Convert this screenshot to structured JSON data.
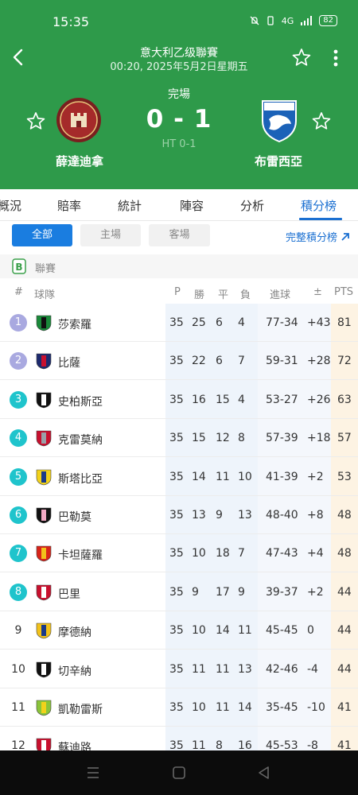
{
  "status_bar": {
    "time": "15:35",
    "net": "4G",
    "battery": "82"
  },
  "match": {
    "league": "意大利乙级聯賽",
    "datetime": "00:20, 2025年5月2日星期五",
    "status": "完場",
    "score": "0 - 1",
    "halftime": "HT 0-1",
    "home": {
      "name": "薛達迪拿"
    },
    "away": {
      "name": "布雷西亞"
    }
  },
  "tabs": [
    {
      "label": "概況"
    },
    {
      "label": "賠率"
    },
    {
      "label": "統計"
    },
    {
      "label": "陣容"
    },
    {
      "label": "分析"
    },
    {
      "label": "積分榜",
      "active": true
    }
  ],
  "filters": [
    {
      "label": "全部",
      "active": true
    },
    {
      "label": "主場"
    },
    {
      "label": "客場"
    }
  ],
  "full_table_link": "完整積分榜",
  "league_section": "聯賽",
  "columns": {
    "rank": "#",
    "team": "球隊",
    "p": "P",
    "w": "勝",
    "d": "平",
    "l": "負",
    "goals": "進球",
    "diff": "±",
    "pts": "PTS"
  },
  "colors": {
    "header_green": "#2e9a4a",
    "accent_blue": "#1a6fd1",
    "promo": "#a9a9e0",
    "playoff": "#1fc4cc"
  },
  "standings": [
    {
      "rank": "1",
      "team": "莎索羅",
      "p": "35",
      "w": "25",
      "d": "6",
      "l": "4",
      "goals": "77-34",
      "diff": "+43",
      "pts": "81",
      "badge": "promo",
      "crest": [
        "#1a8a3a",
        "#111111"
      ]
    },
    {
      "rank": "2",
      "team": "比薩",
      "p": "35",
      "w": "22",
      "d": "6",
      "l": "7",
      "goals": "59-31",
      "diff": "+28",
      "pts": "72",
      "badge": "promo",
      "crest": [
        "#1c2a6e",
        "#c8102e"
      ]
    },
    {
      "rank": "3",
      "team": "史柏斯亞",
      "p": "35",
      "w": "16",
      "d": "15",
      "l": "4",
      "goals": "53-27",
      "diff": "+26",
      "pts": "63",
      "badge": "playoff",
      "crest": [
        "#111111",
        "#ffffff"
      ]
    },
    {
      "rank": "4",
      "team": "克雷莫納",
      "p": "35",
      "w": "15",
      "d": "12",
      "l": "8",
      "goals": "57-39",
      "diff": "+18",
      "pts": "57",
      "badge": "playoff",
      "crest": [
        "#c8102e",
        "#9aa0a8"
      ]
    },
    {
      "rank": "5",
      "team": "斯塔比亞",
      "p": "35",
      "w": "14",
      "d": "11",
      "l": "10",
      "goals": "41-39",
      "diff": "+2",
      "pts": "53",
      "badge": "playoff",
      "crest": [
        "#f2d21b",
        "#1a3a8a"
      ]
    },
    {
      "rank": "6",
      "team": "巴勒莫",
      "p": "35",
      "w": "13",
      "d": "9",
      "l": "13",
      "goals": "48-40",
      "diff": "+8",
      "pts": "48",
      "badge": "playoff",
      "crest": [
        "#111111",
        "#f3a9c4"
      ]
    },
    {
      "rank": "7",
      "team": "卡坦薩羅",
      "p": "35",
      "w": "10",
      "d": "18",
      "l": "7",
      "goals": "47-43",
      "diff": "+4",
      "pts": "48",
      "badge": "playoff",
      "crest": [
        "#d8241a",
        "#f2c21b"
      ]
    },
    {
      "rank": "8",
      "team": "巴里",
      "p": "35",
      "w": "9",
      "d": "17",
      "l": "9",
      "goals": "39-37",
      "diff": "+2",
      "pts": "44",
      "badge": "playoff",
      "crest": [
        "#c8102e",
        "#ffffff"
      ]
    },
    {
      "rank": "9",
      "team": "摩德納",
      "p": "35",
      "w": "10",
      "d": "14",
      "l": "11",
      "goals": "45-45",
      "diff": "0",
      "pts": "44",
      "badge": "none",
      "crest": [
        "#f2c21b",
        "#1a3a8a"
      ]
    },
    {
      "rank": "10",
      "team": "切辛納",
      "p": "35",
      "w": "11",
      "d": "11",
      "l": "13",
      "goals": "42-46",
      "diff": "-4",
      "pts": "44",
      "badge": "none",
      "crest": [
        "#111111",
        "#ffffff"
      ]
    },
    {
      "rank": "11",
      "team": "凱勒雷斯",
      "p": "35",
      "w": "10",
      "d": "11",
      "l": "14",
      "goals": "35-45",
      "diff": "-10",
      "pts": "41",
      "badge": "none",
      "crest": [
        "#8ac43a",
        "#f2d21b"
      ]
    },
    {
      "rank": "12",
      "team": "蘇迪路",
      "p": "35",
      "w": "11",
      "d": "8",
      "l": "16",
      "goals": "45-53",
      "diff": "-8",
      "pts": "41",
      "badge": "none",
      "crest": [
        "#c8102e",
        "#ffffff"
      ]
    }
  ]
}
